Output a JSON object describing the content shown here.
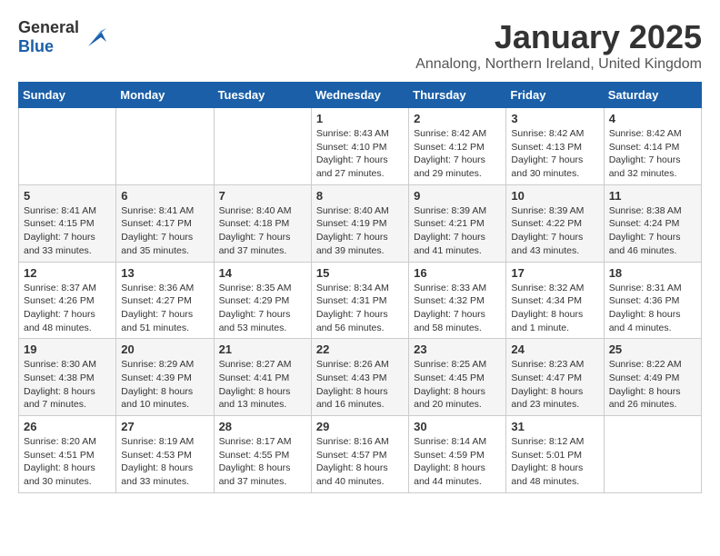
{
  "logo": {
    "general": "General",
    "blue": "Blue"
  },
  "title": {
    "month_year": "January 2025",
    "location": "Annalong, Northern Ireland, United Kingdom"
  },
  "days_of_week": [
    "Sunday",
    "Monday",
    "Tuesday",
    "Wednesday",
    "Thursday",
    "Friday",
    "Saturday"
  ],
  "weeks": [
    [
      {
        "day": "",
        "info": ""
      },
      {
        "day": "",
        "info": ""
      },
      {
        "day": "",
        "info": ""
      },
      {
        "day": "1",
        "info": "Sunrise: 8:43 AM\nSunset: 4:10 PM\nDaylight: 7 hours and 27 minutes."
      },
      {
        "day": "2",
        "info": "Sunrise: 8:42 AM\nSunset: 4:12 PM\nDaylight: 7 hours and 29 minutes."
      },
      {
        "day": "3",
        "info": "Sunrise: 8:42 AM\nSunset: 4:13 PM\nDaylight: 7 hours and 30 minutes."
      },
      {
        "day": "4",
        "info": "Sunrise: 8:42 AM\nSunset: 4:14 PM\nDaylight: 7 hours and 32 minutes."
      }
    ],
    [
      {
        "day": "5",
        "info": "Sunrise: 8:41 AM\nSunset: 4:15 PM\nDaylight: 7 hours and 33 minutes."
      },
      {
        "day": "6",
        "info": "Sunrise: 8:41 AM\nSunset: 4:17 PM\nDaylight: 7 hours and 35 minutes."
      },
      {
        "day": "7",
        "info": "Sunrise: 8:40 AM\nSunset: 4:18 PM\nDaylight: 7 hours and 37 minutes."
      },
      {
        "day": "8",
        "info": "Sunrise: 8:40 AM\nSunset: 4:19 PM\nDaylight: 7 hours and 39 minutes."
      },
      {
        "day": "9",
        "info": "Sunrise: 8:39 AM\nSunset: 4:21 PM\nDaylight: 7 hours and 41 minutes."
      },
      {
        "day": "10",
        "info": "Sunrise: 8:39 AM\nSunset: 4:22 PM\nDaylight: 7 hours and 43 minutes."
      },
      {
        "day": "11",
        "info": "Sunrise: 8:38 AM\nSunset: 4:24 PM\nDaylight: 7 hours and 46 minutes."
      }
    ],
    [
      {
        "day": "12",
        "info": "Sunrise: 8:37 AM\nSunset: 4:26 PM\nDaylight: 7 hours and 48 minutes."
      },
      {
        "day": "13",
        "info": "Sunrise: 8:36 AM\nSunset: 4:27 PM\nDaylight: 7 hours and 51 minutes."
      },
      {
        "day": "14",
        "info": "Sunrise: 8:35 AM\nSunset: 4:29 PM\nDaylight: 7 hours and 53 minutes."
      },
      {
        "day": "15",
        "info": "Sunrise: 8:34 AM\nSunset: 4:31 PM\nDaylight: 7 hours and 56 minutes."
      },
      {
        "day": "16",
        "info": "Sunrise: 8:33 AM\nSunset: 4:32 PM\nDaylight: 7 hours and 58 minutes."
      },
      {
        "day": "17",
        "info": "Sunrise: 8:32 AM\nSunset: 4:34 PM\nDaylight: 8 hours and 1 minute."
      },
      {
        "day": "18",
        "info": "Sunrise: 8:31 AM\nSunset: 4:36 PM\nDaylight: 8 hours and 4 minutes."
      }
    ],
    [
      {
        "day": "19",
        "info": "Sunrise: 8:30 AM\nSunset: 4:38 PM\nDaylight: 8 hours and 7 minutes."
      },
      {
        "day": "20",
        "info": "Sunrise: 8:29 AM\nSunset: 4:39 PM\nDaylight: 8 hours and 10 minutes."
      },
      {
        "day": "21",
        "info": "Sunrise: 8:27 AM\nSunset: 4:41 PM\nDaylight: 8 hours and 13 minutes."
      },
      {
        "day": "22",
        "info": "Sunrise: 8:26 AM\nSunset: 4:43 PM\nDaylight: 8 hours and 16 minutes."
      },
      {
        "day": "23",
        "info": "Sunrise: 8:25 AM\nSunset: 4:45 PM\nDaylight: 8 hours and 20 minutes."
      },
      {
        "day": "24",
        "info": "Sunrise: 8:23 AM\nSunset: 4:47 PM\nDaylight: 8 hours and 23 minutes."
      },
      {
        "day": "25",
        "info": "Sunrise: 8:22 AM\nSunset: 4:49 PM\nDaylight: 8 hours and 26 minutes."
      }
    ],
    [
      {
        "day": "26",
        "info": "Sunrise: 8:20 AM\nSunset: 4:51 PM\nDaylight: 8 hours and 30 minutes."
      },
      {
        "day": "27",
        "info": "Sunrise: 8:19 AM\nSunset: 4:53 PM\nDaylight: 8 hours and 33 minutes."
      },
      {
        "day": "28",
        "info": "Sunrise: 8:17 AM\nSunset: 4:55 PM\nDaylight: 8 hours and 37 minutes."
      },
      {
        "day": "29",
        "info": "Sunrise: 8:16 AM\nSunset: 4:57 PM\nDaylight: 8 hours and 40 minutes."
      },
      {
        "day": "30",
        "info": "Sunrise: 8:14 AM\nSunset: 4:59 PM\nDaylight: 8 hours and 44 minutes."
      },
      {
        "day": "31",
        "info": "Sunrise: 8:12 AM\nSunset: 5:01 PM\nDaylight: 8 hours and 48 minutes."
      },
      {
        "day": "",
        "info": ""
      }
    ]
  ]
}
